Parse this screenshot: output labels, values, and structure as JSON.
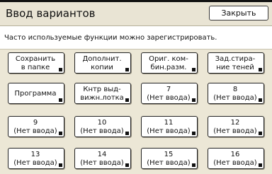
{
  "header": {
    "title": "Ввод вариантов",
    "close_label": "Закрыть"
  },
  "hint": "Часто используемые функции можно зарегистрировать.",
  "buttons": [
    {
      "line1": "Сохранить",
      "line2": "в папке"
    },
    {
      "line1": "Дополнит.",
      "line2": "копии"
    },
    {
      "line1": "Ориг. ком-",
      "line2": "бин.разм."
    },
    {
      "line1": "Зад.стира-",
      "line2": "ние теней"
    },
    {
      "line1": "Программа",
      "line2": ""
    },
    {
      "line1": "Кнтр выд-",
      "line2": "вижн.лотка"
    },
    {
      "line1": "7",
      "line2": "(Нет ввода)"
    },
    {
      "line1": "8",
      "line2": "(Нет ввода)"
    },
    {
      "line1": "9",
      "line2": "(Нет ввода)"
    },
    {
      "line1": "10",
      "line2": "(Нет ввода)"
    },
    {
      "line1": "11",
      "line2": "(Нет ввода)"
    },
    {
      "line1": "12",
      "line2": "(Нет ввода)"
    },
    {
      "line1": "13",
      "line2": "(Нет ввода)"
    },
    {
      "line1": "14",
      "line2": "(Нет ввода)"
    },
    {
      "line1": "15",
      "line2": "(Нет ввода)"
    },
    {
      "line1": "16",
      "line2": "(Нет ввода)"
    }
  ]
}
